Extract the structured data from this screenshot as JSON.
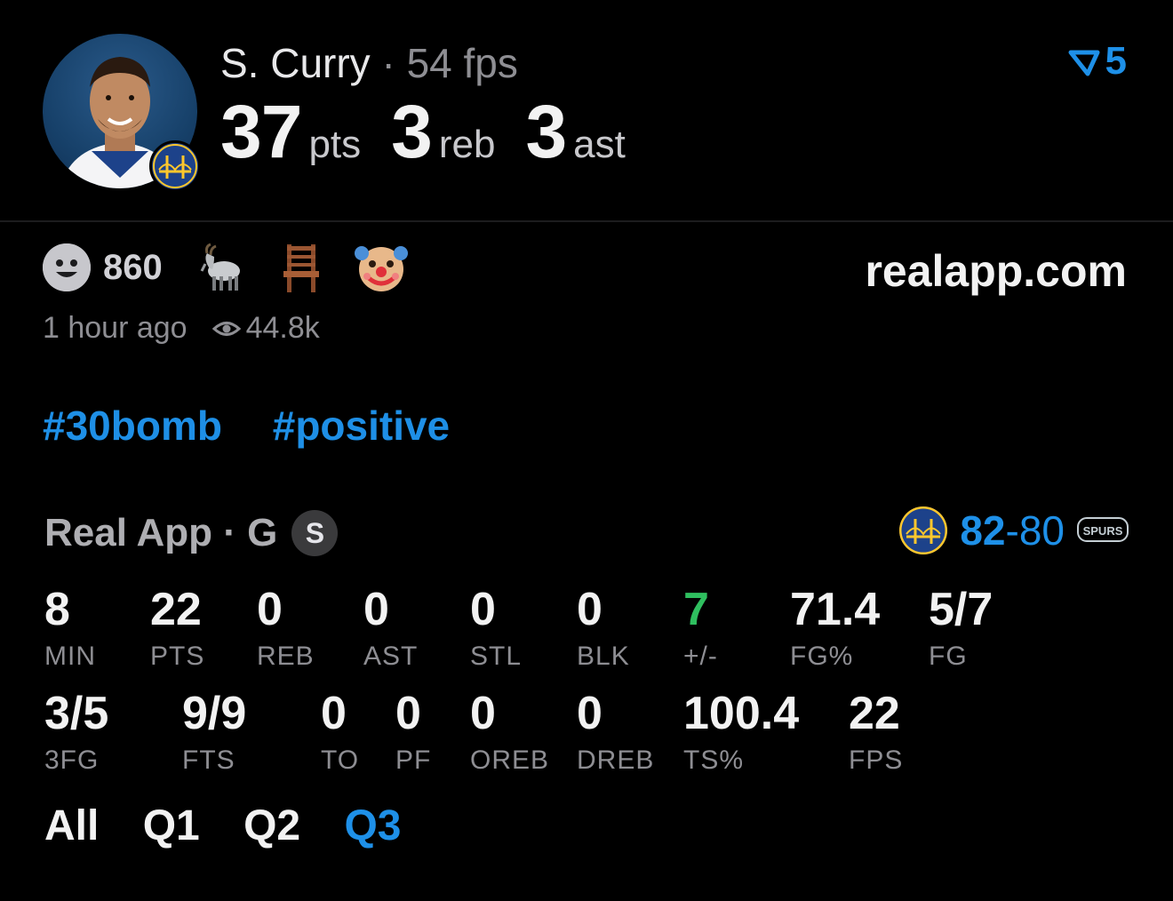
{
  "header": {
    "player_name": "S. Curry",
    "separator": "·",
    "fps_text": "54 fps",
    "pts_value": "37",
    "pts_unit": "pts",
    "reb_value": "3",
    "reb_unit": "reb",
    "ast_value": "3",
    "ast_unit": "ast",
    "rank_value": "5",
    "accent": "#1e90e8"
  },
  "reactions": {
    "count": "860",
    "icons": [
      "smiley-icon",
      "goat-emoji",
      "chair-emoji",
      "clown-emoji"
    ],
    "site": "realapp.com"
  },
  "meta": {
    "time": "1 hour ago",
    "views": "44.8k"
  },
  "tags": [
    "#30bomb",
    "#positive"
  ],
  "game": {
    "source": "Real App · G",
    "position_badge": "S",
    "home_score": "82",
    "dash": "-",
    "away_score": "80",
    "spurs_label": "SPURS"
  },
  "stats_row1": [
    {
      "value": "8",
      "label": "MIN"
    },
    {
      "value": "22",
      "label": "PTS"
    },
    {
      "value": "0",
      "label": "REB"
    },
    {
      "value": "0",
      "label": "AST"
    },
    {
      "value": "0",
      "label": "STL"
    },
    {
      "value": "0",
      "label": "BLK"
    },
    {
      "value": "7",
      "label": "+/-"
    },
    {
      "value": "71.4",
      "label": "FG%"
    },
    {
      "value": "5/7",
      "label": "FG"
    }
  ],
  "stats_row2": [
    {
      "value": "3/5",
      "label": "3FG"
    },
    {
      "value": "9/9",
      "label": "FTS"
    },
    {
      "value": "0",
      "label": "TO"
    },
    {
      "value": "0",
      "label": "PF"
    },
    {
      "value": "0",
      "label": "OREB"
    },
    {
      "value": "0",
      "label": "DREB"
    },
    {
      "value": "100.4",
      "label": "TS%"
    },
    {
      "value": "22",
      "label": "FPS"
    }
  ],
  "quarters": [
    "All",
    "Q1",
    "Q2",
    "Q3"
  ],
  "active_quarter": "Q3"
}
